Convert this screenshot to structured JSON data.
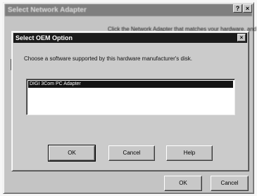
{
  "background_dialog": {
    "title": "Select Network Adapter",
    "help_glyph": "?",
    "close_glyph": "×",
    "instruction": "Click the Network Adapter that matches your hardware, and then",
    "ok_label": "OK",
    "cancel_label": "Cancel"
  },
  "oem_dialog": {
    "title": "Select OEM Option",
    "close_glyph": "×",
    "prompt": "Choose a software supported by this hardware manufacturer's disk.",
    "options": [
      "DIGI 3Com PC Adapter"
    ],
    "selected_index": 0,
    "ok_label": "OK",
    "cancel_label": "Cancel",
    "help_label": "Help"
  },
  "colors": {
    "active_titlebar": "#1b1b1b",
    "inactive_titlebar": "#7f7f7f",
    "dialog_face": "#cbcbcb",
    "selection": "#141414"
  }
}
